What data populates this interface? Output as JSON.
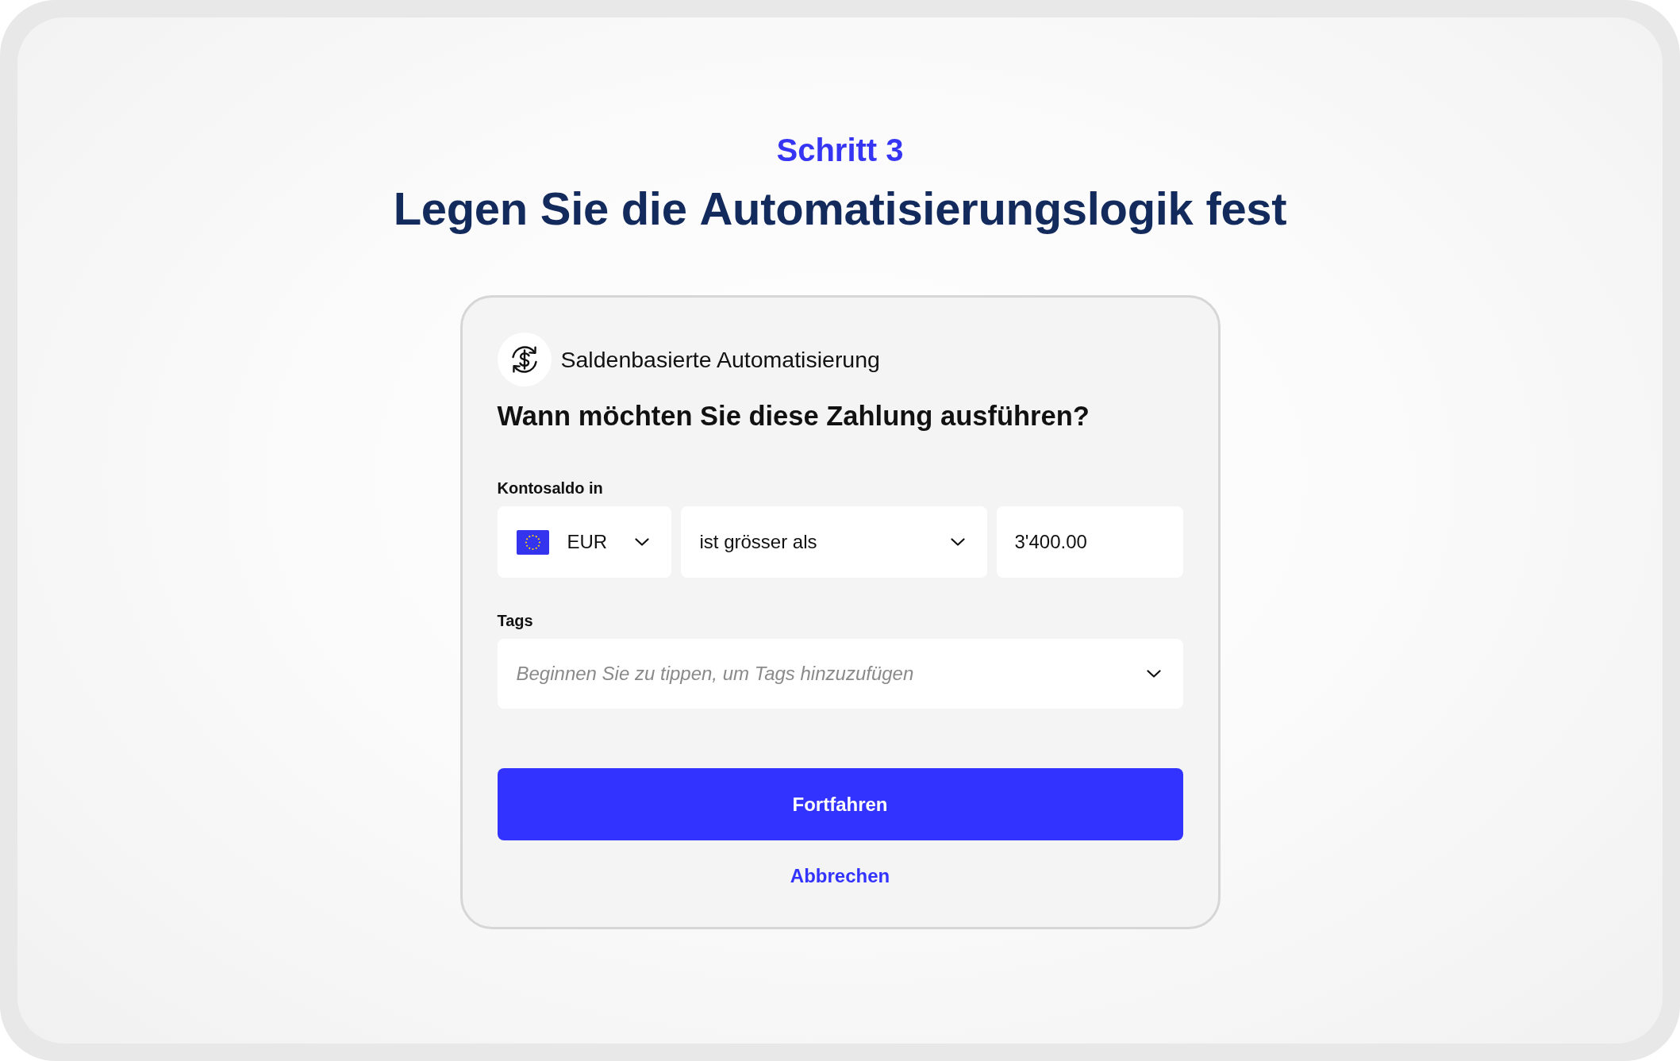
{
  "step_label": "Schritt 3",
  "title": "Legen Sie die **Automatisierungslogik** fest",
  "card": {
    "automation_type": "Saldenbasierte Automatisierung",
    "question": "Wann möchten Sie diese Zahlung ausführen?",
    "balance_label": "Kontosaldo in",
    "balance_fields": [
      {
        "kind": "currency",
        "value": "EUR"
      },
      {
        "kind": "select",
        "value": "ist grösser als"
      },
      {
        "kind": "input",
        "value": "3'400.00"
      }
    ],
    "tags_label": "Tags",
    "tags_field": {
      "placeholder": "Beginnen Sie zu tippen, um Tags hinzuzufügen"
    },
    "continue_button": "Fortfahren",
    "cancel_link": "Abbrechen"
  }
}
